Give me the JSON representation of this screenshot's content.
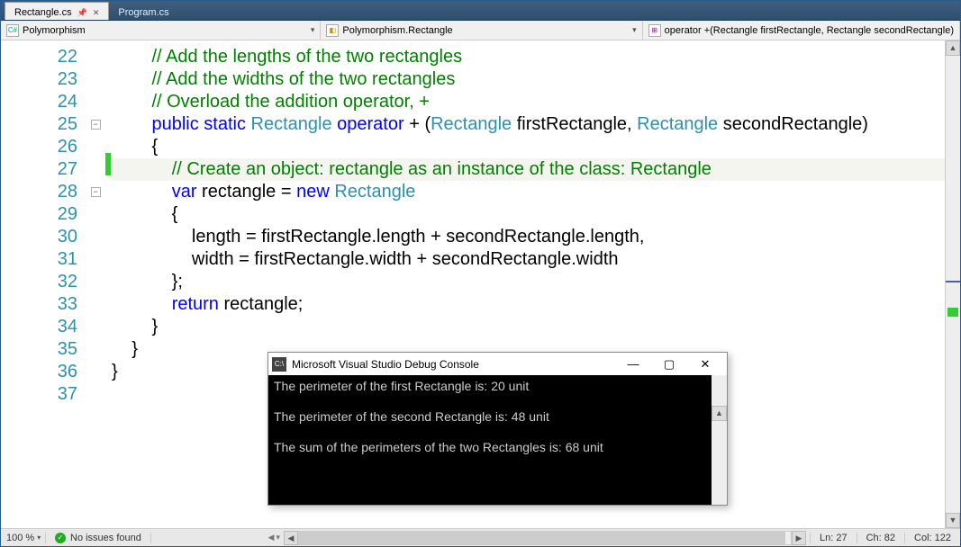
{
  "tabs": [
    {
      "label": "Rectangle.cs",
      "active": true,
      "pinned": true
    },
    {
      "label": "Program.cs",
      "active": false,
      "pinned": false
    }
  ],
  "combos": {
    "project": "Polymorphism",
    "class": "Polymorphism.Rectangle",
    "member": "operator +(Rectangle firstRectangle, Rectangle secondRectangle)"
  },
  "gutter": {
    "start": 22,
    "end": 37
  },
  "code_lines": [
    {
      "n": 22,
      "fold": "",
      "chg": "",
      "hl": false,
      "tokens": [
        {
          "t": "        ",
          "c": ""
        },
        {
          "t": "// Add the lengths of the two rectangles",
          "c": "c-comment"
        }
      ]
    },
    {
      "n": 23,
      "fold": "",
      "chg": "",
      "hl": false,
      "tokens": [
        {
          "t": "        ",
          "c": ""
        },
        {
          "t": "// Add the widths of the two rectangles",
          "c": "c-comment"
        }
      ]
    },
    {
      "n": 24,
      "fold": "",
      "chg": "",
      "hl": false,
      "tokens": [
        {
          "t": "        ",
          "c": ""
        },
        {
          "t": "// Overload the addition operator, +",
          "c": "c-comment"
        }
      ]
    },
    {
      "n": 25,
      "fold": "box",
      "chg": "",
      "hl": false,
      "tokens": [
        {
          "t": "        ",
          "c": ""
        },
        {
          "t": "public static ",
          "c": "c-kw"
        },
        {
          "t": "Rectangle ",
          "c": "c-type"
        },
        {
          "t": "operator ",
          "c": "c-kw"
        },
        {
          "t": "+ (",
          "c": ""
        },
        {
          "t": "Rectangle ",
          "c": "c-type"
        },
        {
          "t": "firstRectangle, ",
          "c": ""
        },
        {
          "t": "Rectangle ",
          "c": "c-type"
        },
        {
          "t": "secondRectangle)",
          "c": ""
        }
      ]
    },
    {
      "n": 26,
      "fold": "",
      "chg": "",
      "hl": false,
      "tokens": [
        {
          "t": "        {",
          "c": ""
        }
      ]
    },
    {
      "n": 27,
      "fold": "",
      "chg": "G",
      "hl": true,
      "tokens": [
        {
          "t": "            ",
          "c": ""
        },
        {
          "t": "// Create an object: rectangle as an instance of the class: Rectangle",
          "c": "c-comment"
        }
      ]
    },
    {
      "n": 28,
      "fold": "box",
      "chg": "",
      "hl": false,
      "tokens": [
        {
          "t": "            ",
          "c": ""
        },
        {
          "t": "var ",
          "c": "c-kw"
        },
        {
          "t": "rectangle = ",
          "c": ""
        },
        {
          "t": "new ",
          "c": "c-kw"
        },
        {
          "t": "Rectangle",
          "c": "c-type"
        }
      ]
    },
    {
      "n": 29,
      "fold": "",
      "chg": "",
      "hl": false,
      "tokens": [
        {
          "t": "            {",
          "c": ""
        }
      ]
    },
    {
      "n": 30,
      "fold": "",
      "chg": "",
      "hl": false,
      "tokens": [
        {
          "t": "                length = firstRectangle.length + secondRectangle.length,",
          "c": ""
        }
      ]
    },
    {
      "n": 31,
      "fold": "",
      "chg": "",
      "hl": false,
      "tokens": [
        {
          "t": "                width = firstRectangle.width + secondRectangle.width",
          "c": ""
        }
      ]
    },
    {
      "n": 32,
      "fold": "",
      "chg": "",
      "hl": false,
      "tokens": [
        {
          "t": "            };",
          "c": ""
        }
      ]
    },
    {
      "n": 33,
      "fold": "",
      "chg": "",
      "hl": false,
      "tokens": [
        {
          "t": "            ",
          "c": ""
        },
        {
          "t": "return ",
          "c": "c-kw"
        },
        {
          "t": "rectangle;",
          "c": ""
        }
      ]
    },
    {
      "n": 34,
      "fold": "",
      "chg": "",
      "hl": false,
      "tokens": [
        {
          "t": "        }",
          "c": ""
        }
      ]
    },
    {
      "n": 35,
      "fold": "",
      "chg": "",
      "hl": false,
      "tokens": [
        {
          "t": "    }",
          "c": ""
        }
      ]
    },
    {
      "n": 36,
      "fold": "",
      "chg": "",
      "hl": false,
      "tokens": [
        {
          "t": "}",
          "c": ""
        }
      ]
    },
    {
      "n": 37,
      "fold": "",
      "chg": "",
      "hl": false,
      "tokens": []
    }
  ],
  "console": {
    "title": "Microsoft Visual Studio Debug Console",
    "lines": [
      "The perimeter of the first Rectangle is: 20 unit",
      "",
      "The perimeter of the second Rectangle is: 48 unit",
      "",
      "The sum of the perimeters of the two Rectangles is: 68 unit"
    ]
  },
  "status": {
    "zoom": "100 %",
    "issues": "No issues found",
    "ln_label": "Ln:",
    "ln": "27",
    "ch_label": "Ch:",
    "ch": "82",
    "col_label": "Col:",
    "col": "122"
  }
}
